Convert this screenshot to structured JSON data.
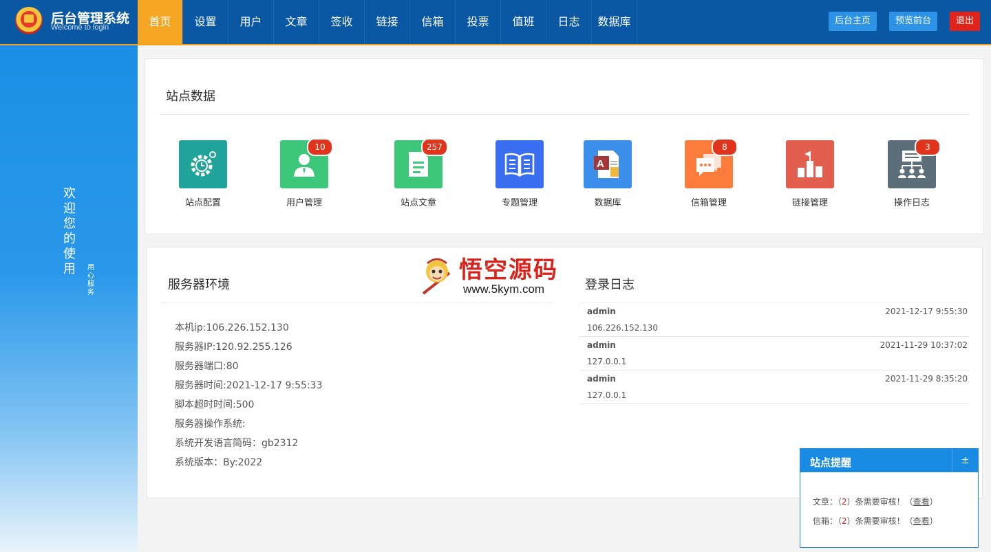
{
  "header": {
    "title": "后台管理系统",
    "subtitle": "Welcome to login",
    "nav": [
      "首页",
      "设置",
      "用户",
      "文章",
      "签收",
      "链接",
      "信箱",
      "投票",
      "值班",
      "日志",
      "数据库"
    ],
    "actions": {
      "admin_home": "后台主页",
      "preview": "预览前台",
      "logout": "退出"
    }
  },
  "sidebar": {
    "welcome": [
      "欢",
      "迎",
      "您",
      "的",
      "使",
      "用"
    ],
    "sub": [
      "用",
      "心",
      "服",
      "务"
    ]
  },
  "site_data": {
    "title": "站点数据",
    "items": [
      {
        "label": "站点配置",
        "badge": null,
        "color": "#1fa39b",
        "icon": "gear-clock-icon"
      },
      {
        "label": "用户管理",
        "badge": "10",
        "color": "#3cc77b",
        "icon": "user-icon"
      },
      {
        "label": "站点文章",
        "badge": "257",
        "color": "#3cc77b",
        "icon": "document-icon"
      },
      {
        "label": "专题管理",
        "badge": null,
        "color": "#3a6ef0",
        "icon": "book-icon"
      },
      {
        "label": "数据库",
        "badge": null,
        "color": "#3b8ee9",
        "icon": "database-icon"
      },
      {
        "label": "信箱管理",
        "badge": "8",
        "color": "#fb7c3b",
        "icon": "message-icon"
      },
      {
        "label": "链接管理",
        "badge": null,
        "color": "#e25e4f",
        "icon": "flag-chart-icon"
      },
      {
        "label": "操作日志",
        "badge": "3",
        "color": "#5b6e7a",
        "icon": "org-chart-icon"
      }
    ]
  },
  "server": {
    "title": "服务器环境",
    "lines": [
      "本机ip:106.226.152.130",
      "服务器IP:120.92.255.126",
      "服务器端口:80",
      "服务器时间:2021-12-17 9:55:33",
      "脚本超时时间:500",
      "服务器操作系统:",
      "系统开发语言简码：gb2312",
      "系统版本：By:2022"
    ]
  },
  "login_log": {
    "title": "登录日志",
    "rows": [
      {
        "user": "admin",
        "time": "2021-12-17 9:55:30",
        "ip": "106.226.152.130"
      },
      {
        "user": "admin",
        "time": "2021-11-29 10:37:02",
        "ip": "127.0.0.1"
      },
      {
        "user": "admin",
        "time": "2021-11-29 8:35:20",
        "ip": "127.0.0.1"
      }
    ]
  },
  "watermark": {
    "text": "悟空源码",
    "url": "www.5kym.com"
  },
  "reminder": {
    "title": "站点提醒",
    "toggle": "±",
    "lines": [
      {
        "prefix": "文章：（",
        "count": "2",
        "middle": "）条需要审核！（",
        "link": "查看",
        "suffix": "）"
      },
      {
        "prefix": "信箱：（",
        "count": "2",
        "middle": "）条需要审核！（",
        "link": "查看",
        "suffix": "）"
      }
    ]
  }
}
